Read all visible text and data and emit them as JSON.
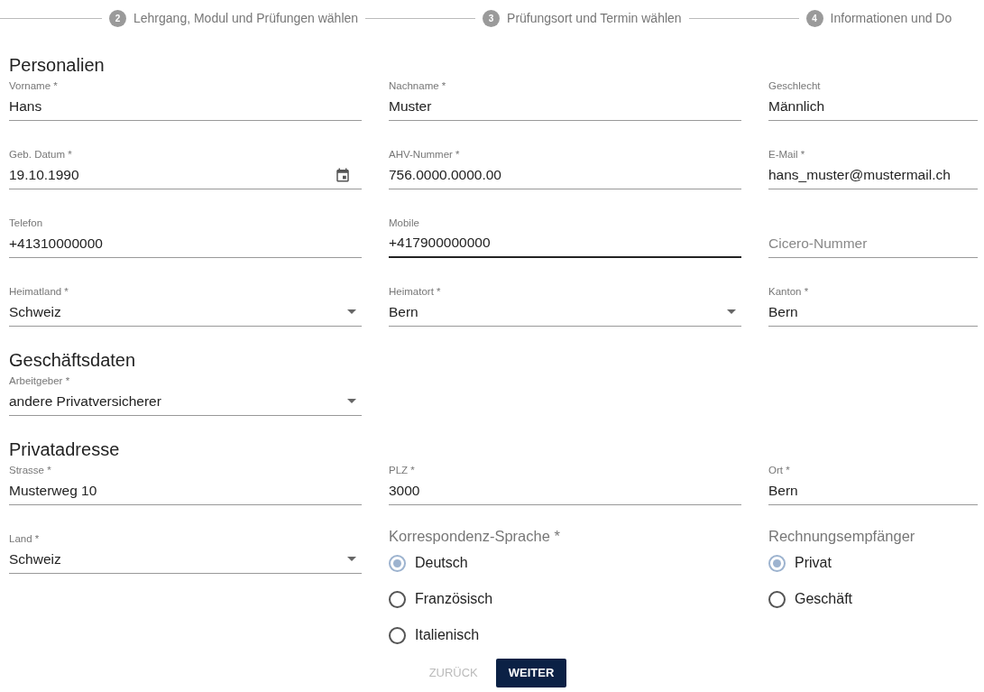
{
  "stepper": [
    {
      "number": "2",
      "label": "Lehrgang, Modul und Prüfungen wählen"
    },
    {
      "number": "3",
      "label": "Prüfungsort und Termin wählen"
    },
    {
      "number": "4",
      "label": "Informationen und Do"
    }
  ],
  "sections": [
    {
      "title": "Personalien",
      "fields": [
        {
          "kind": "text",
          "label": "Vorname *",
          "value": "Hans"
        },
        {
          "kind": "text",
          "label": "Nachname *",
          "value": "Muster"
        },
        {
          "kind": "text",
          "label": "Geschlecht",
          "value": "Männlich"
        },
        {
          "kind": "date",
          "label": "Geb. Datum *",
          "value": "19.10.1990"
        },
        {
          "kind": "text",
          "label": "AHV-Nummer *",
          "value": "756.0000.0000.00"
        },
        {
          "kind": "text",
          "label": "E-Mail *",
          "value": "hans_muster@mustermail.ch"
        },
        {
          "kind": "text",
          "label": "Telefon",
          "value": "+41310000000"
        },
        {
          "kind": "text",
          "label": "Mobile",
          "value": "+417900000000",
          "focused": true
        },
        {
          "kind": "text",
          "placeholder": "Cicero-Nummer"
        },
        {
          "kind": "select",
          "label": "Heimatland *",
          "value": "Schweiz"
        },
        {
          "kind": "select",
          "label": "Heimatort *",
          "value": "Bern"
        },
        {
          "kind": "text",
          "label": "Kanton *",
          "value": "Bern"
        }
      ]
    },
    {
      "title": "Geschäftsdaten",
      "fields": [
        {
          "kind": "select",
          "label": "Arbeitgeber *",
          "value": "andere Privatversicherer"
        }
      ]
    },
    {
      "title": "Privatadresse",
      "fields": [
        {
          "kind": "text",
          "label": "Strasse *",
          "value": "Musterweg 10"
        },
        {
          "kind": "text",
          "label": "PLZ *",
          "value": "3000"
        },
        {
          "kind": "text",
          "label": "Ort *",
          "value": "Bern"
        },
        {
          "kind": "select",
          "label": "Land *",
          "value": "Schweiz"
        },
        {
          "kind": "radio",
          "label": "Korrespondenz-Sprache *",
          "options": [
            {
              "label": "Deutsch",
              "selected": true
            },
            {
              "label": "Französisch",
              "selected": false
            },
            {
              "label": "Italienisch",
              "selected": false
            }
          ]
        },
        {
          "kind": "radio",
          "label": "Rechnungsempfänger",
          "options": [
            {
              "label": "Privat",
              "selected": true
            },
            {
              "label": "Geschäft",
              "selected": false
            }
          ]
        }
      ]
    }
  ],
  "buttons": [
    {
      "label": "ZURÜCK",
      "disabled": true
    },
    {
      "label": "WEITER",
      "disabled": false
    }
  ]
}
